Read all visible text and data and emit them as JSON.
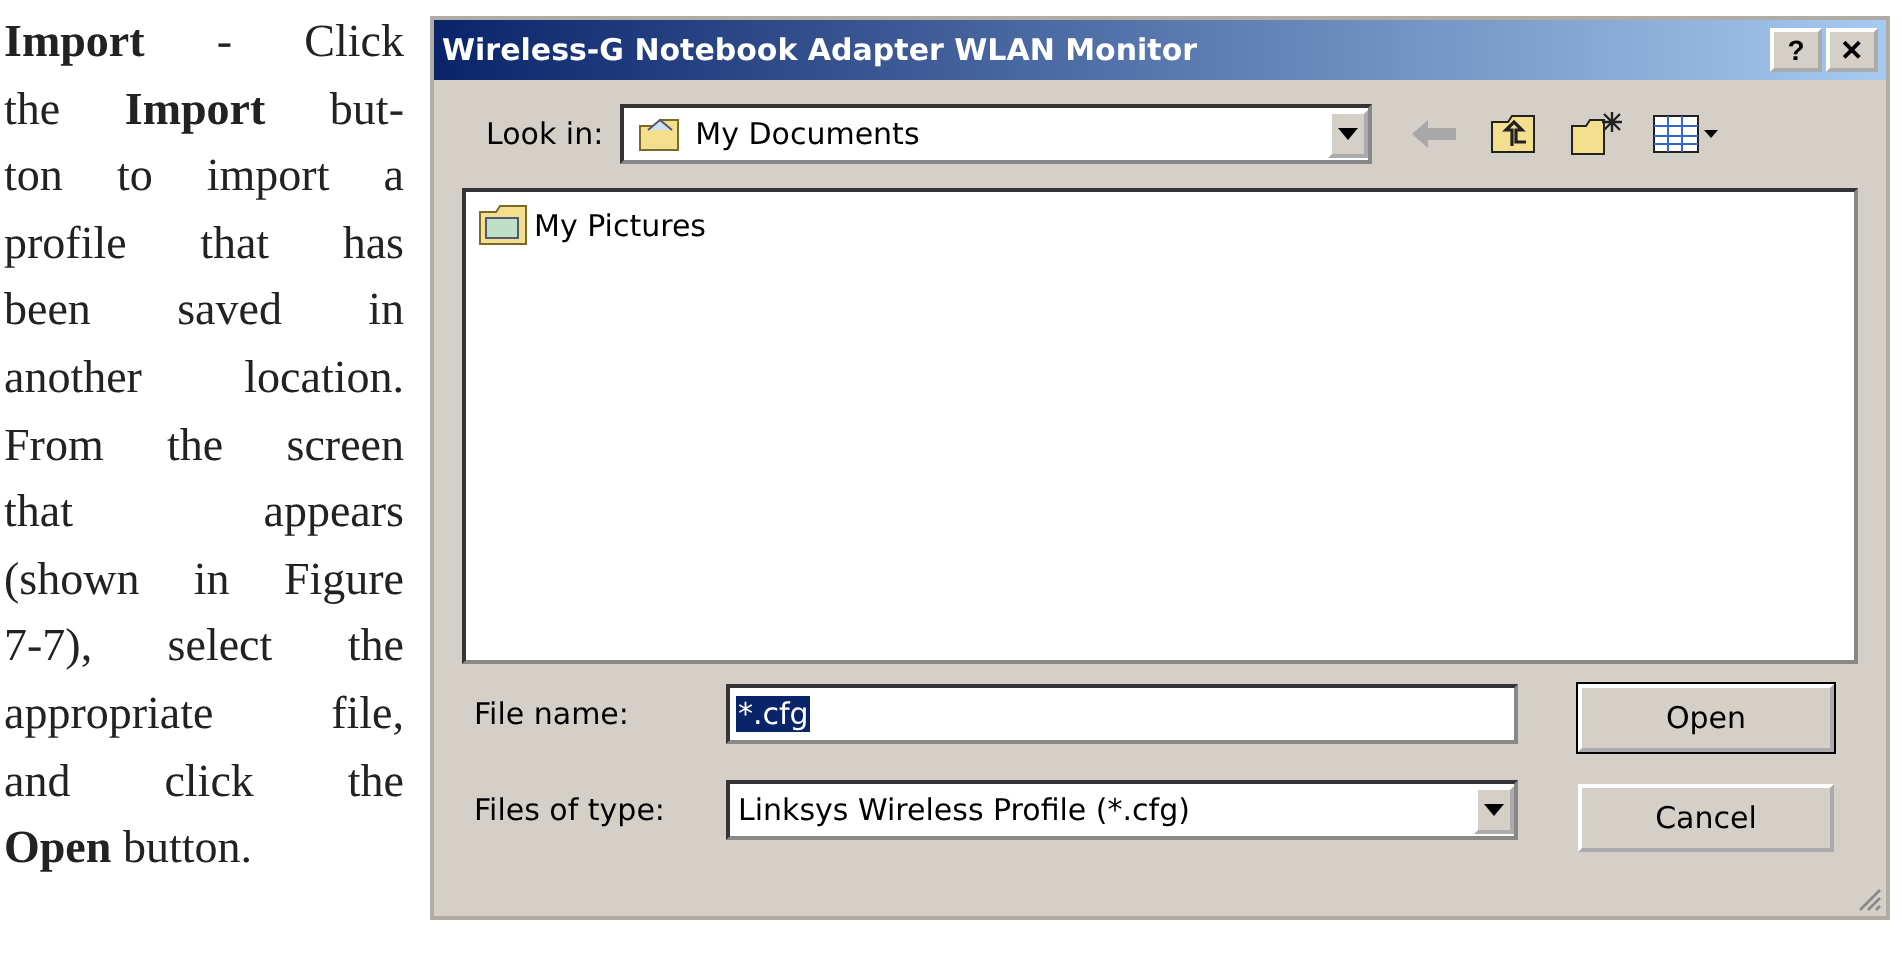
{
  "paragraph": {
    "lines": [
      "**Import** - Click",
      "the **Import** but-",
      "ton to import a",
      "profile that has",
      "been saved in",
      "another location.",
      "From the screen",
      "that appears",
      "(shown in Figure",
      "7-7), select the",
      "appropriate file,",
      "and click the",
      "**Open** button."
    ]
  },
  "window": {
    "title": "Wireless-G Notebook Adapter WLAN Monitor",
    "help": "?",
    "close": "✕"
  },
  "look_in": {
    "label": "Look in:",
    "value": "My Documents"
  },
  "files": [
    {
      "name": "My Pictures",
      "selected": false
    }
  ],
  "file_name": {
    "label": "File name:",
    "value": "*.cfg"
  },
  "file_type": {
    "label": "Files of type:",
    "value": "Linksys Wireless Profile (*.cfg)"
  },
  "buttons": [
    {
      "label": "Open",
      "default": true
    },
    {
      "label": "Cancel",
      "default": false
    }
  ]
}
